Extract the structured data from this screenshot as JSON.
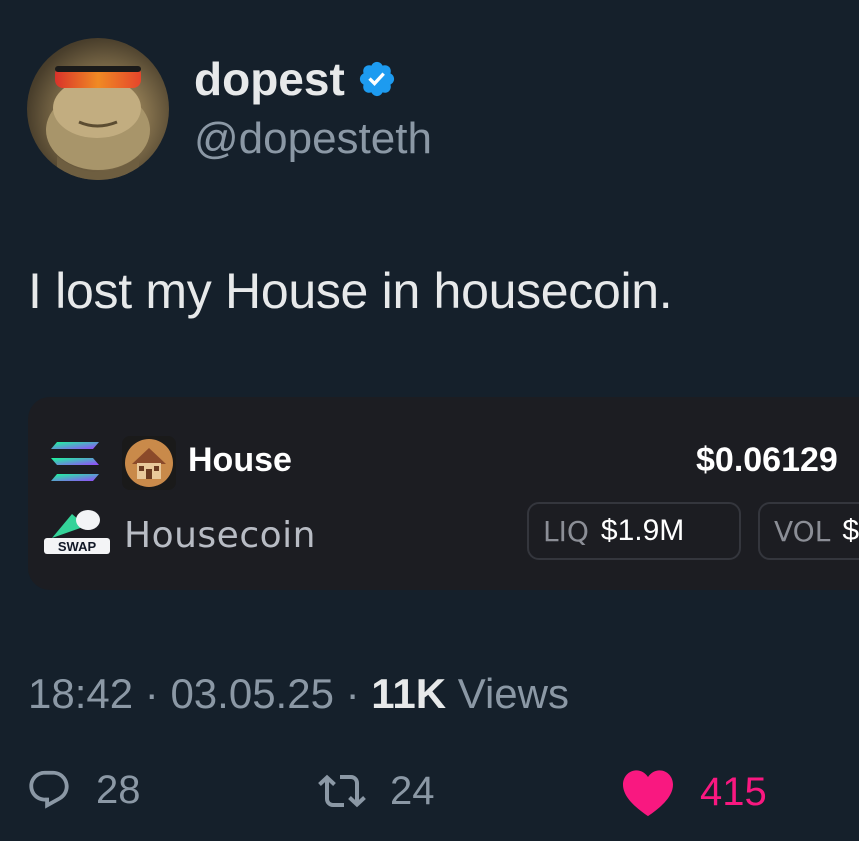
{
  "author": {
    "display_name": "dopest",
    "handle": "@dopesteth",
    "verified_icon": "verified-badge-icon"
  },
  "tweet": {
    "text": "I lost my House in housecoin."
  },
  "card": {
    "chain_icon": "solana-icon",
    "dex_logo": "swap-logo",
    "dex_logo_text": "SWAP",
    "token_symbol": "House",
    "token_name": "Housecoin",
    "price": "$0.06129",
    "liq_label": "LIQ",
    "liq_value": "$1.9M",
    "vol_label": "VOL",
    "vol_value": "$"
  },
  "meta": {
    "time": "18:42",
    "date": "03.05.25",
    "views_count": "11K",
    "views_label": "Views",
    "separator": "·"
  },
  "actions": {
    "replies": "28",
    "retweets": "24",
    "likes": "415"
  },
  "colors": {
    "background": "#15202b",
    "like": "#f91880",
    "verified": "#1d9bf0",
    "card_bg": "#1c1d22"
  }
}
